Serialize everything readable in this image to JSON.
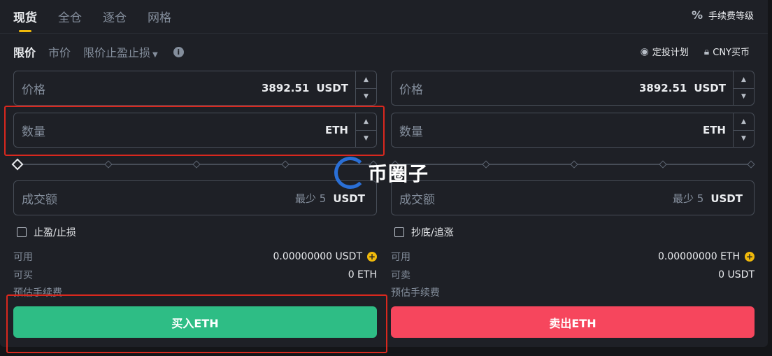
{
  "tabs": [
    "现货",
    "全仓",
    "逐仓",
    "网格"
  ],
  "fee_link": {
    "icon": "percent-icon",
    "label": "手续费等级"
  },
  "order_types": {
    "limit": "限价",
    "market": "市价",
    "stop_limit": "限价止盈止损"
  },
  "right_links": {
    "auto_invest": "定投计划",
    "buy_cny": "CNY买币"
  },
  "buy": {
    "price_label": "价格",
    "price_value": "3892.51",
    "price_unit": "USDT",
    "amount_label": "数量",
    "amount_unit": "ETH",
    "total_label": "成交额",
    "total_min": "最少 5",
    "total_unit": "USDT",
    "checkbox_label": "止盈/止损",
    "available_label": "可用",
    "available_value": "0.00000000 USDT",
    "can_buy_label": "可买",
    "can_buy_value": "0 ETH",
    "fee_label": "预估手续费",
    "button": "买入ETH"
  },
  "sell": {
    "price_label": "价格",
    "price_value": "3892.51",
    "price_unit": "USDT",
    "amount_label": "数量",
    "amount_unit": "ETH",
    "total_label": "成交额",
    "total_min": "最少 5",
    "total_unit": "USDT",
    "checkbox_label": "抄底/追涨",
    "available_label": "可用",
    "available_value": "0.00000000 ETH",
    "can_sell_label": "可卖",
    "can_sell_value": "0 USDT",
    "fee_label": "预估手续费",
    "button": "卖出ETH"
  },
  "watermark": "币圈子",
  "colors": {
    "buy": "#2ebd85",
    "sell": "#f6465d",
    "accent": "#f0b90b",
    "annotation": "#d9281e"
  }
}
